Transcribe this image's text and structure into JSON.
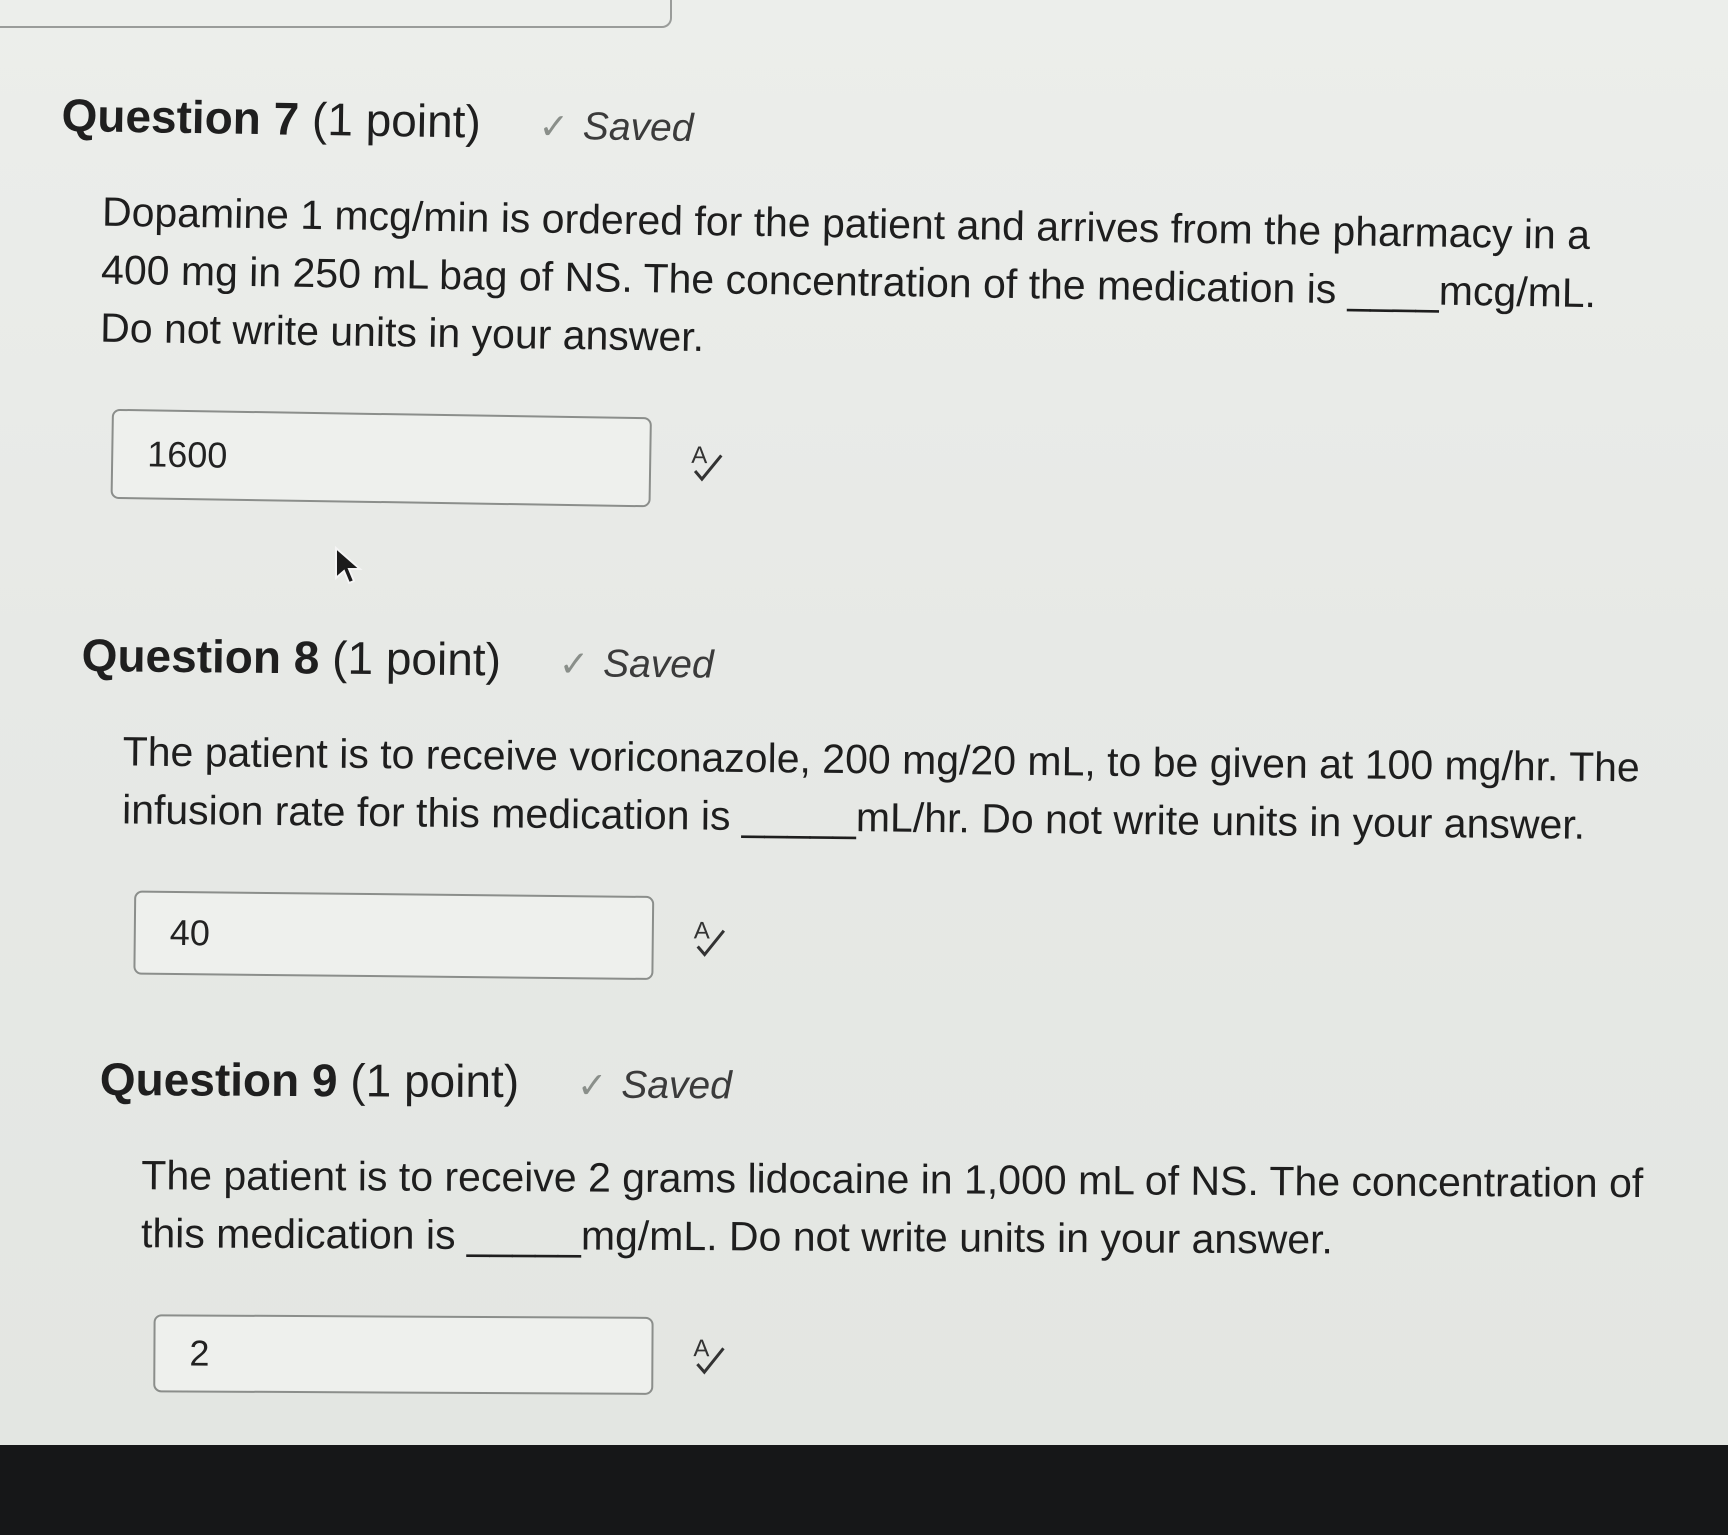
{
  "questions": [
    {
      "title": "Question 7",
      "points": "(1 point)",
      "status": "Saved",
      "lines": [
        "Dopamine 1 mcg/min is ordered for the patient and arrives from the pharmacy in a",
        "400 mg in 250 mL bag of NS. The concentration of the medication is ____mcg/mL.",
        "Do not write units in your answer."
      ],
      "answer": "1600"
    },
    {
      "title": "Question 8",
      "points": "(1 point)",
      "status": "Saved",
      "lines": [
        "The patient is to receive voriconazole, 200 mg/20 mL, to be given at 100 mg/hr. The",
        "infusion rate for this medication is _____mL/hr. Do not write units in your answer."
      ],
      "answer": "40"
    },
    {
      "title": "Question 9",
      "points": "(1 point)",
      "status": "Saved",
      "lines": [
        "The patient is to receive 2 grams lidocaine in 1,000 mL of NS. The concentration of",
        "this medication is _____mg/mL. Do not write units in your answer."
      ],
      "answer": "2"
    }
  ],
  "icons": {
    "status": "check-icon",
    "spell_check": "spell-check-icon",
    "pointer": "mouse-cursor-icon"
  }
}
